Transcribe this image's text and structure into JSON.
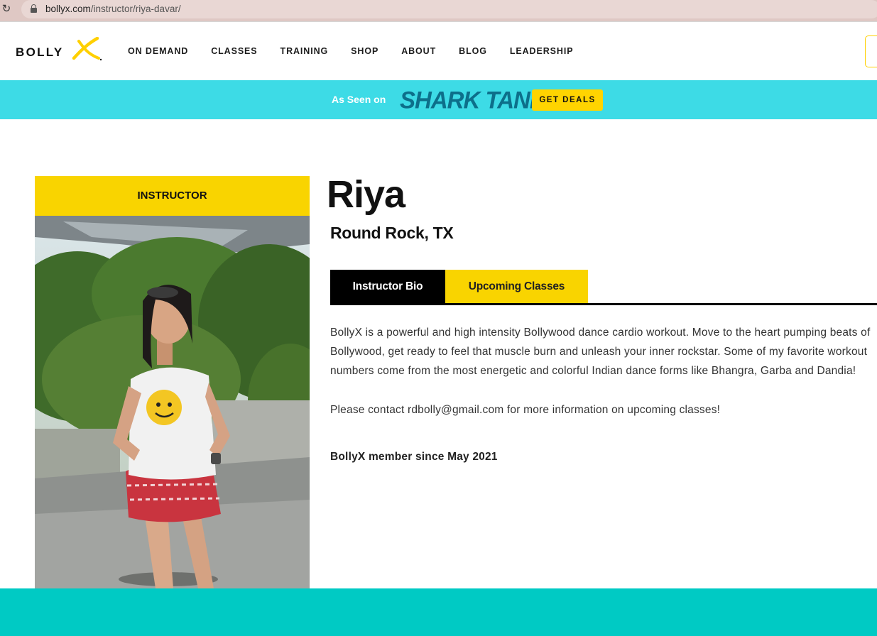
{
  "browser": {
    "url_host": "bollyx.com",
    "url_path": "/instructor/riya-davar/",
    "reload_icon": "reload-icon",
    "lock_icon": "lock-icon"
  },
  "header": {
    "logo_text": "BOLLY",
    "logo_mark_color": "#ffd000",
    "nav": [
      {
        "label": "ON DEMAND"
      },
      {
        "label": "CLASSES"
      },
      {
        "label": "TRAINING"
      },
      {
        "label": "SHOP"
      },
      {
        "label": "ABOUT"
      },
      {
        "label": "BLOG"
      },
      {
        "label": "LEADERSHIP"
      }
    ]
  },
  "promo": {
    "as_seen_on": "As Seen on",
    "show_logo": "SHARK TANK",
    "cta_label": "GET DEALS",
    "background": "#3ddbe6",
    "cta_color": "#ffd400"
  },
  "instructor": {
    "card_label": "INSTRUCTOR",
    "name": "Riya",
    "location": "Round Rock, TX",
    "tabs": [
      {
        "label": "Instructor Bio",
        "active": true
      },
      {
        "label": "Upcoming Classes",
        "active": false
      }
    ],
    "bio": "BollyX is a powerful and high intensity Bollywood dance cardio workout. Move to the heart pumping beats of Bollywood, get ready to feel that muscle burn and unleash your inner rockstar. Some of my favorite workout numbers come from the most energetic and colorful Indian dance forms like Bhangra, Garba and Dandia!",
    "contact": "Please contact rdbolly@gmail.com for more information on upcoming classes!",
    "member_since": "BollyX member since May 2021"
  },
  "colors": {
    "accent_yellow": "#f9d400",
    "footer_teal": "#00cac4"
  }
}
